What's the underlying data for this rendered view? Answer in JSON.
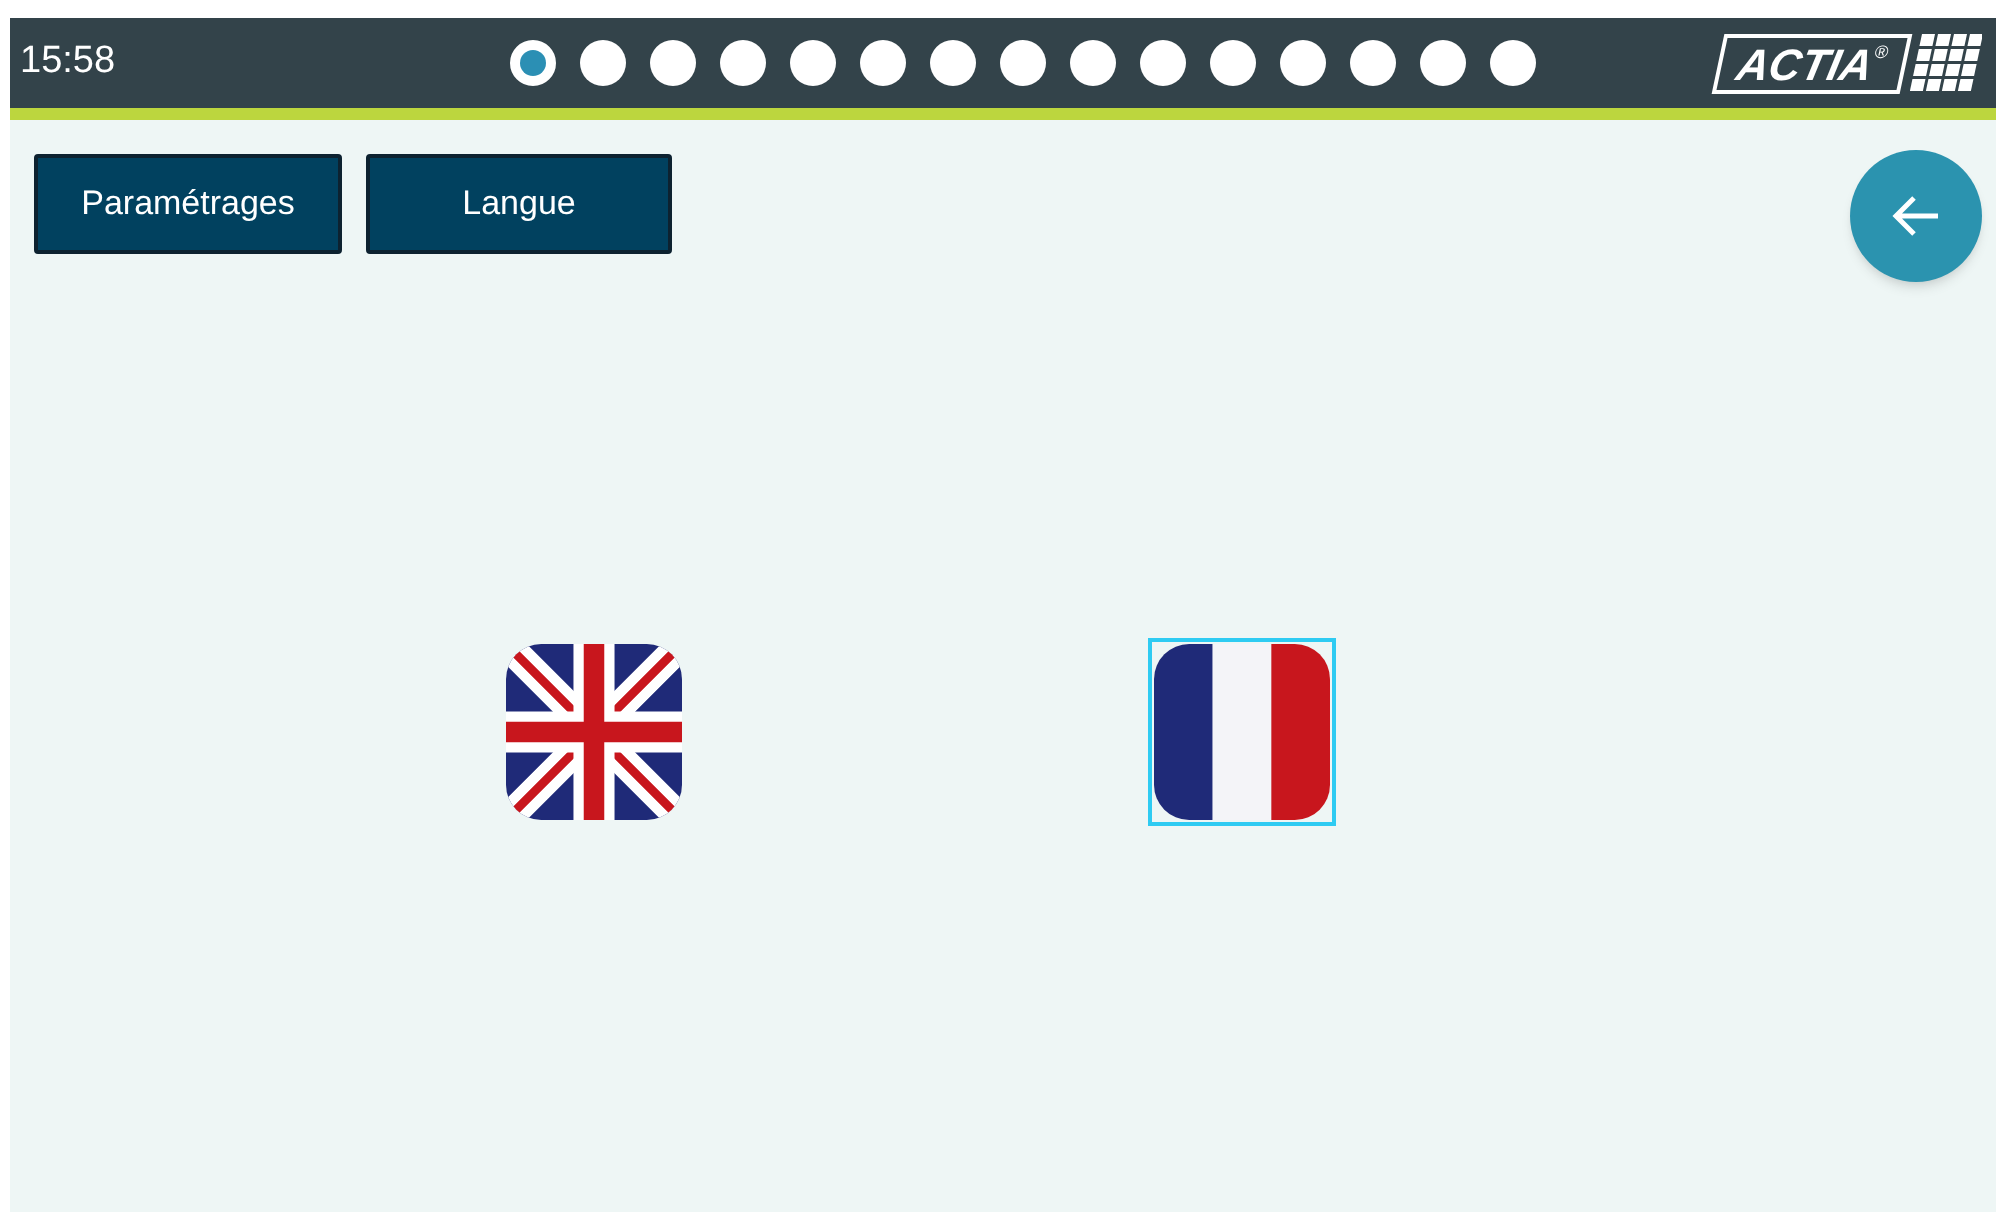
{
  "status_bar": {
    "time": "15:58",
    "pages": [
      {
        "selected": true
      },
      {
        "selected": false
      },
      {
        "selected": false
      },
      {
        "selected": false
      },
      {
        "selected": false
      },
      {
        "selected": false
      },
      {
        "selected": false
      },
      {
        "selected": false
      },
      {
        "selected": false
      },
      {
        "selected": false
      },
      {
        "selected": false
      },
      {
        "selected": false
      },
      {
        "selected": false
      },
      {
        "selected": false
      },
      {
        "selected": false
      }
    ],
    "logo": {
      "text": "ACTIA",
      "mark": "®"
    }
  },
  "breadcrumbs": [
    "Paramétrages",
    "Langue"
  ],
  "languages": [
    {
      "kind": "uk",
      "selected": false
    },
    {
      "kind": "fr",
      "selected": true
    }
  ]
}
